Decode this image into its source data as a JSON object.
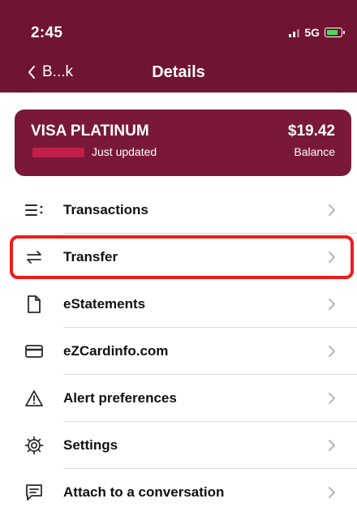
{
  "status_bar": {
    "time": "2:45",
    "network": "5G"
  },
  "nav": {
    "back_label": "B...k",
    "title": "Details"
  },
  "card": {
    "name": "VISA PLATINUM",
    "updated": "Just updated",
    "balance": "$19.42",
    "balance_label": "Balance"
  },
  "menu": {
    "items": [
      {
        "label": "Transactions",
        "icon": "list-icon"
      },
      {
        "label": "Transfer",
        "icon": "transfer-arrows-icon"
      },
      {
        "label": "eStatements",
        "icon": "document-icon"
      },
      {
        "label": "eZCardinfo.com",
        "icon": "credit-card-icon"
      },
      {
        "label": "Alert preferences",
        "icon": "warning-icon"
      },
      {
        "label": "Settings",
        "icon": "gear-icon"
      },
      {
        "label": "Attach to a conversation",
        "icon": "chat-icon"
      }
    ]
  },
  "colors": {
    "brand": "#6f1431",
    "card": "#7a1839",
    "highlight": "#ee1c1c"
  }
}
